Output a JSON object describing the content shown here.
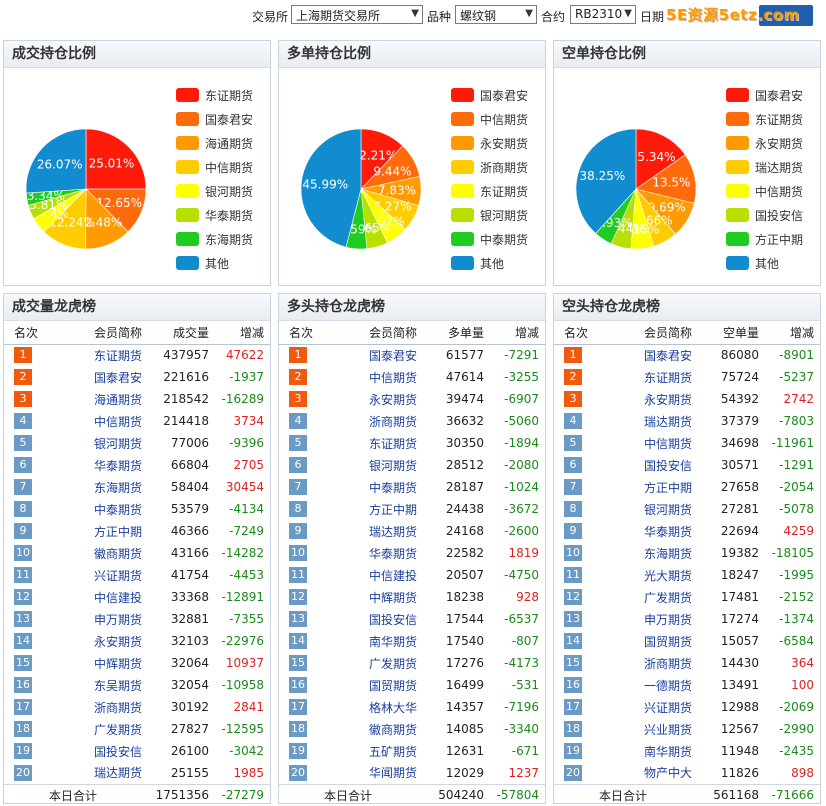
{
  "filters": {
    "exchange_label": "交易所",
    "exchange_value": "上海期货交易所",
    "variety_label": "品种",
    "variety_value": "螺纹钢",
    "contract_label": "合约",
    "contract_value": "RB2310",
    "date_label": "日期",
    "watermark": "5E资源5etz.com"
  },
  "colors": [
    "#ff1a0a",
    "#ff6a0a",
    "#ff9a00",
    "#ffcc00",
    "#ffff00",
    "#b7e000",
    "#1fcc1f",
    "#118ccf"
  ],
  "chart_data": [
    {
      "type": "pie",
      "title": "成交持仓比例",
      "categories": [
        "东证期货",
        "国泰君安",
        "海通期货",
        "中信期货",
        "银河期货",
        "华泰期货",
        "东海期货",
        "其他"
      ],
      "values": [
        25.01,
        12.65,
        12.48,
        12.24,
        4.4,
        3.81,
        3.34,
        26.07
      ],
      "labels": [
        "25.01%",
        "12.65%",
        "12.48%",
        "12.24%",
        "4.4%",
        "3.81%",
        "3.34%",
        "26.07%"
      ],
      "legend": "right"
    },
    {
      "type": "pie",
      "title": "多单持仓比例",
      "categories": [
        "国泰君安",
        "中信期货",
        "永安期货",
        "浙商期货",
        "东证期货",
        "银河期货",
        "中泰期货",
        "其他"
      ],
      "values": [
        12.21,
        9.44,
        7.83,
        7.27,
        6.02,
        5.65,
        5.59,
        45.99
      ],
      "labels": [
        "12.21%",
        "9.44%",
        "7.83%",
        "7.27%",
        "6.02%",
        "5.65%",
        "5.59%",
        "45.99%"
      ],
      "legend": "right"
    },
    {
      "type": "pie",
      "title": "空单持仓比例",
      "categories": [
        "国泰君安",
        "东证期货",
        "永安期货",
        "瑞达期货",
        "中信期货",
        "国投安信",
        "方正中期",
        "其他"
      ],
      "values": [
        15.34,
        13.5,
        9.69,
        6.66,
        6.15,
        5.44,
        4.93,
        38.25
      ],
      "labels": [
        "15.34%",
        "13.5%",
        "9.69%",
        "6.66%",
        "6.15%",
        "5.44%",
        "4.93%",
        "38.25%"
      ],
      "legend": "right"
    }
  ],
  "tables": [
    {
      "title": "成交量龙虎榜",
      "headers": [
        "名次",
        "会员简称",
        "成交量",
        "增减"
      ],
      "rows": [
        [
          "1",
          "东证期货",
          "437957",
          "47622"
        ],
        [
          "2",
          "国泰君安",
          "221616",
          "-1937"
        ],
        [
          "3",
          "海通期货",
          "218542",
          "-16289"
        ],
        [
          "4",
          "中信期货",
          "214418",
          "3734"
        ],
        [
          "5",
          "银河期货",
          "77006",
          "-9396"
        ],
        [
          "6",
          "华泰期货",
          "66804",
          "2705"
        ],
        [
          "7",
          "东海期货",
          "58404",
          "30454"
        ],
        [
          "8",
          "中泰期货",
          "53579",
          "-4134"
        ],
        [
          "9",
          "方正中期",
          "46366",
          "-7249"
        ],
        [
          "10",
          "徽商期货",
          "43166",
          "-14282"
        ],
        [
          "11",
          "兴证期货",
          "41754",
          "-4453"
        ],
        [
          "12",
          "中信建投",
          "33368",
          "-12891"
        ],
        [
          "13",
          "申万期货",
          "32881",
          "-7355"
        ],
        [
          "14",
          "永安期货",
          "32103",
          "-22976"
        ],
        [
          "15",
          "中辉期货",
          "32064",
          "10937"
        ],
        [
          "16",
          "东吴期货",
          "32054",
          "-10958"
        ],
        [
          "17",
          "浙商期货",
          "30192",
          "2841"
        ],
        [
          "18",
          "广发期货",
          "27827",
          "-12595"
        ],
        [
          "19",
          "国投安信",
          "26100",
          "-3042"
        ],
        [
          "20",
          "瑞达期货",
          "25155",
          "1985"
        ]
      ],
      "total": [
        "本日合计",
        "1751356",
        "-27279"
      ]
    },
    {
      "title": "多头持仓龙虎榜",
      "headers": [
        "名次",
        "会员简称",
        "多单量",
        "增减"
      ],
      "rows": [
        [
          "1",
          "国泰君安",
          "61577",
          "-7291"
        ],
        [
          "2",
          "中信期货",
          "47614",
          "-3255"
        ],
        [
          "3",
          "永安期货",
          "39474",
          "-6907"
        ],
        [
          "4",
          "浙商期货",
          "36632",
          "-5060"
        ],
        [
          "5",
          "东证期货",
          "30350",
          "-1894"
        ],
        [
          "6",
          "银河期货",
          "28512",
          "-2080"
        ],
        [
          "7",
          "中泰期货",
          "28187",
          "-1024"
        ],
        [
          "8",
          "方正中期",
          "24438",
          "-3672"
        ],
        [
          "9",
          "瑞达期货",
          "24168",
          "-2600"
        ],
        [
          "10",
          "华泰期货",
          "22582",
          "1819"
        ],
        [
          "11",
          "中信建投",
          "20507",
          "-4750"
        ],
        [
          "12",
          "中辉期货",
          "18238",
          "928"
        ],
        [
          "13",
          "国投安信",
          "17544",
          "-6537"
        ],
        [
          "14",
          "南华期货",
          "17540",
          "-807"
        ],
        [
          "15",
          "广发期货",
          "17276",
          "-4173"
        ],
        [
          "16",
          "国贸期货",
          "16499",
          "-531"
        ],
        [
          "17",
          "格林大华",
          "14357",
          "-7196"
        ],
        [
          "18",
          "徽商期货",
          "14085",
          "-3340"
        ],
        [
          "19",
          "五矿期货",
          "12631",
          "-671"
        ],
        [
          "20",
          "华闻期货",
          "12029",
          "1237"
        ]
      ],
      "total": [
        "本日合计",
        "504240",
        "-57804"
      ]
    },
    {
      "title": "空头持仓龙虎榜",
      "headers": [
        "名次",
        "会员简称",
        "空单量",
        "增减"
      ],
      "rows": [
        [
          "1",
          "国泰君安",
          "86080",
          "-8901"
        ],
        [
          "2",
          "东证期货",
          "75724",
          "-5237"
        ],
        [
          "3",
          "永安期货",
          "54392",
          "2742"
        ],
        [
          "4",
          "瑞达期货",
          "37379",
          "-7803"
        ],
        [
          "5",
          "中信期货",
          "34698",
          "-11961"
        ],
        [
          "6",
          "国投安信",
          "30571",
          "-1291"
        ],
        [
          "7",
          "方正中期",
          "27658",
          "-2054"
        ],
        [
          "8",
          "银河期货",
          "27281",
          "-5078"
        ],
        [
          "9",
          "华泰期货",
          "22694",
          "4259"
        ],
        [
          "10",
          "东海期货",
          "19382",
          "-18105"
        ],
        [
          "11",
          "光大期货",
          "18247",
          "-1995"
        ],
        [
          "12",
          "广发期货",
          "17481",
          "-2152"
        ],
        [
          "13",
          "申万期货",
          "17274",
          "-1374"
        ],
        [
          "14",
          "国贸期货",
          "15057",
          "-6584"
        ],
        [
          "15",
          "浙商期货",
          "14430",
          "364"
        ],
        [
          "16",
          "一德期货",
          "13491",
          "100"
        ],
        [
          "17",
          "兴证期货",
          "12988",
          "-2069"
        ],
        [
          "18",
          "兴业期货",
          "12567",
          "-2990"
        ],
        [
          "19",
          "南华期货",
          "11948",
          "-2435"
        ],
        [
          "20",
          "物产中大",
          "11826",
          "898"
        ]
      ],
      "total": [
        "本日合计",
        "561168",
        "-71666"
      ]
    }
  ]
}
